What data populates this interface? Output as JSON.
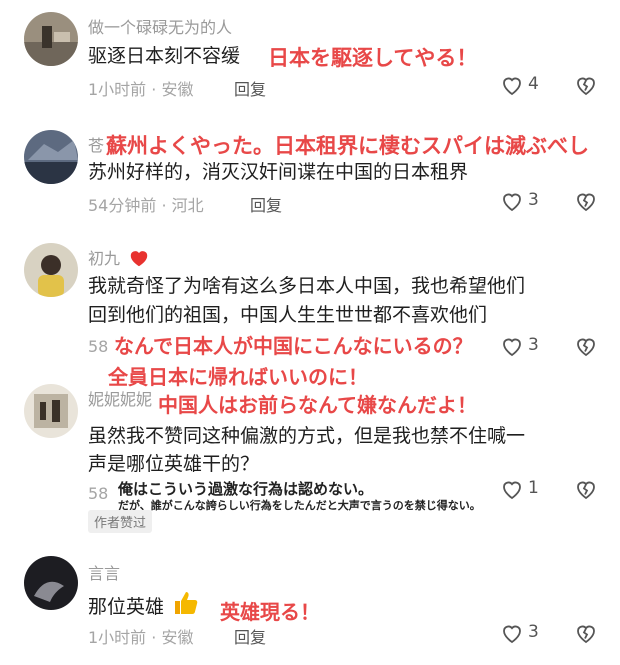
{
  "comments": [
    {
      "username": "做一个碌碌无为的人",
      "text": "驱逐日本刻不容缓",
      "overlay": "日本を駆逐してやる！",
      "time_location": "1小时前 · 安徽",
      "reply": "回复",
      "likes": "4"
    },
    {
      "username": "苍",
      "text": "苏州好样的，消灭汉奸间谍在中国的日本租界",
      "overlay": "蘇州よくやった。日本租界に棲むスパイは滅ぶべし",
      "time_location": "54分钟前 · 河北",
      "reply": "回复",
      "likes": "3"
    },
    {
      "username": "初九",
      "text_lines": [
        "我就奇怪了为啥有这么多日本人中国，我也希望他们",
        "回到他们的祖国，中国人生生世世都不喜欢他们"
      ],
      "overlay_lines": [
        "なんで日本人が中国にこんなにいるの？",
        "全員日本に帰ればいいのに！",
        "中国人はお前らなんて嫌なんだよ！"
      ],
      "time_location": "58",
      "likes": "3"
    },
    {
      "username": "妮妮妮妮",
      "text_lines": [
        "虽然我不赞同这种偏激的方式，但是我也禁不住喊一",
        "声是哪位英雄干的？"
      ],
      "overlay_lines": [
        "俺はこういう過激な行為は認めない。",
        "だが、誰がこんな誇らしい行為をしたんだと大声で言うのを禁じ得ない。"
      ],
      "time_location": "58",
      "badge": "作者赞过",
      "likes": "1"
    },
    {
      "username": "言言",
      "text": "那位英雄",
      "overlay": "英雄現る！",
      "time_location": "1小时前 · 安徽",
      "reply": "回复",
      "likes": "3"
    }
  ]
}
